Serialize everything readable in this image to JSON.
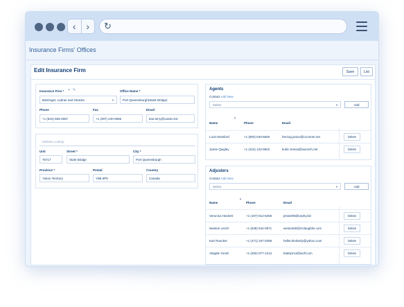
{
  "app": {
    "page_title": "Insurance Firms' Offices",
    "panel_title": "Edit Insurance Firm",
    "save_label": "Save",
    "list_label": "List"
  },
  "icons": {
    "window_dots": [
      "dot-icon",
      "dot-icon",
      "dot-icon"
    ],
    "back": "chevron-left-icon",
    "forward": "chevron-right-icon",
    "reload": "reload-icon",
    "menu": "hamburger-menu-icon",
    "add_firm": "plus-icon",
    "edit_firm": "edit-icon"
  },
  "colors": {
    "chrome": "#cfe0f5",
    "accent": "#0f3d73",
    "link": "#4a86c9"
  },
  "firm": {
    "insurance_firm_label": "Insurance Firm *",
    "insurance_firm_value": "Bahringer, Ledner and Stracke",
    "office_name_label": "Office Name *",
    "office_name_value": "Port Queensburgh(Stark Bridge)",
    "phone_label": "Phone",
    "phone_value": "+1 (844) 559-2557",
    "fax_label": "Fax",
    "fax_value": "+1 (397) 240-0695",
    "email_label": "Email",
    "email_value": "kari.terry@cassin.biz"
  },
  "address": {
    "lookup_placeholder": "Address Lookup",
    "unit_label": "Unit",
    "unit_value": "76717",
    "street_label": "Street *",
    "street_value": "Stark Bridge",
    "city_label": "City *",
    "city_value": "Port Queensburgh",
    "province_label": "Province *",
    "province_value": "Yukon Territory",
    "postal_label": "Postal",
    "postal_value": "Y6B 5P5",
    "country_label": "Country",
    "country_value": "Canada"
  },
  "agents": {
    "title": "Agents",
    "contact_label": "Contact",
    "add_new_label": "Add New",
    "select_placeholder": "Select",
    "add_button": "Add",
    "columns": [
      "Name",
      "Phone",
      "Email"
    ],
    "rows": [
      {
        "name": "Lucie Botsford",
        "phone": "+1 (893) 640-6849",
        "email": "herzog.junius@oconner.net",
        "delete": "Delete"
      },
      {
        "name": "Jamie Quigley",
        "phone": "+1 (424) 123-0823",
        "email": "kuhic.tressa@wunsch.net",
        "delete": "Delete"
      }
    ]
  },
  "adjusters": {
    "title": "Adjusters",
    "contact_label": "Contact",
    "add_new_label": "Add New",
    "select_placeholder": "Select",
    "add_button": "Add",
    "columns": [
      "Name",
      "Phone",
      "Email"
    ],
    "rows": [
      {
        "name": "Veronica Hackett",
        "phone": "+1 (197) 812-8258",
        "email": "jessie09@torphy.biz",
        "delete": "Delete"
      },
      {
        "name": "Newton Lesch",
        "phone": "+1 (538) 544-0971",
        "email": "weston60@mclaughlin.com",
        "delete": "Delete"
      },
      {
        "name": "Kari Ruecker",
        "phone": "+1 (471) 167-0298",
        "email": "heller.kimberly@yahoo.com",
        "delete": "Delete"
      },
      {
        "name": "Abigale Yundt",
        "phone": "+1 (292) 977-1212",
        "email": "katelyn14@wolf.com",
        "delete": "Delete"
      }
    ]
  }
}
